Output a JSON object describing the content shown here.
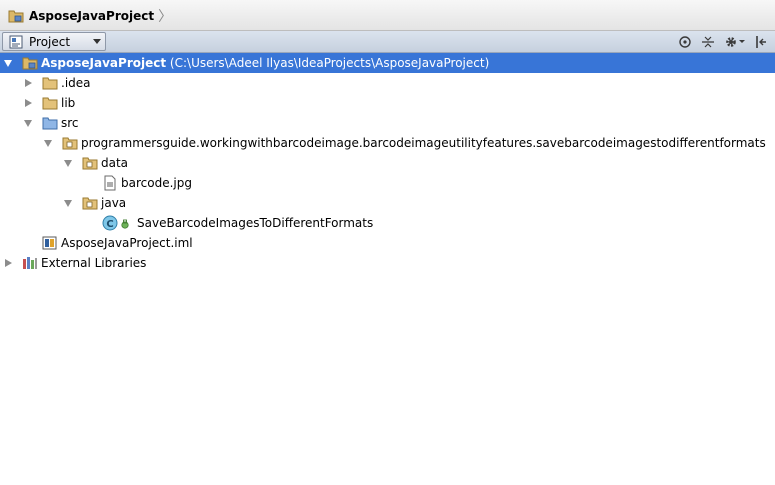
{
  "breadcrumb": {
    "project_name": "AsposeJavaProject"
  },
  "toolwindow": {
    "view_label": "Project"
  },
  "tree": {
    "root": {
      "name": "AsposeJavaProject",
      "path": "(C:\\Users\\Adeel Ilyas\\IdeaProjects\\AsposeJavaProject)"
    },
    "idea": ".idea",
    "lib": "lib",
    "src": "src",
    "package": "programmersguide.workingwithbarcodeimage.barcodeimageutilityfeatures.savebarcodeimagestodifferentformats",
    "data": "data",
    "barcode": "barcode.jpg",
    "java": "java",
    "class": "SaveBarcodeImagesToDifferentFormats",
    "iml": "AsposeJavaProject.iml",
    "external": "External Libraries"
  },
  "colors": {
    "selection": "#3875d7",
    "folder": "#d9b35f",
    "source_folder": "#6f9fd8"
  }
}
